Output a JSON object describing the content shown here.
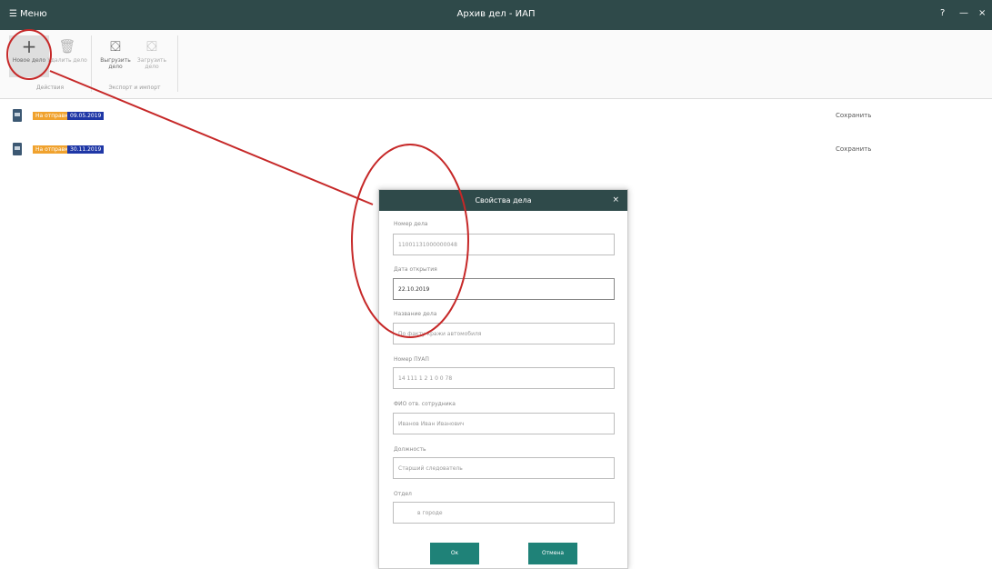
{
  "titlebar": {
    "menu_label": "Меню",
    "title": "Архив дел - ИАП",
    "controls": [
      "?",
      "—",
      "×"
    ]
  },
  "ribbon": {
    "buttons": [
      {
        "label": "Новое дело",
        "icon": "plus-icon"
      },
      {
        "label": "Удалить дело",
        "icon": "trash-icon"
      },
      {
        "label": "Выгрузить дело",
        "icon": "export-icon"
      },
      {
        "label": "Загрузить дело",
        "icon": "import-icon"
      }
    ],
    "groups": [
      "Действия",
      "Экспорт и импорт"
    ]
  },
  "list": {
    "rows": [
      {
        "badge_orange": "На отправке",
        "badge_blue": "09.05.2019",
        "status": "Сохранить"
      },
      {
        "badge_orange": "На отправке",
        "badge_blue": "30.11.2019",
        "status": "Сохранить"
      }
    ]
  },
  "dialog": {
    "title": "Свойства дела",
    "fields": [
      {
        "label": "Номер дела",
        "value": "11001131000000048"
      },
      {
        "label": "Дата открытия",
        "value": "22.10.2019"
      },
      {
        "label": "Название дела",
        "value": "По факту кражи автомобиля"
      },
      {
        "label": "Номер ПУАП",
        "value": "14 111 1 2 1 0 0 78"
      },
      {
        "label": "ФИО отв. сотрудника",
        "value": "Иванов Иван Иванович"
      },
      {
        "label": "Должность",
        "value": "Старший следователь"
      },
      {
        "label": "Отдел",
        "value": "в городе"
      }
    ],
    "ok_label": "Ок",
    "cancel_label": "Отмена"
  },
  "annotation_color": "#c62828"
}
